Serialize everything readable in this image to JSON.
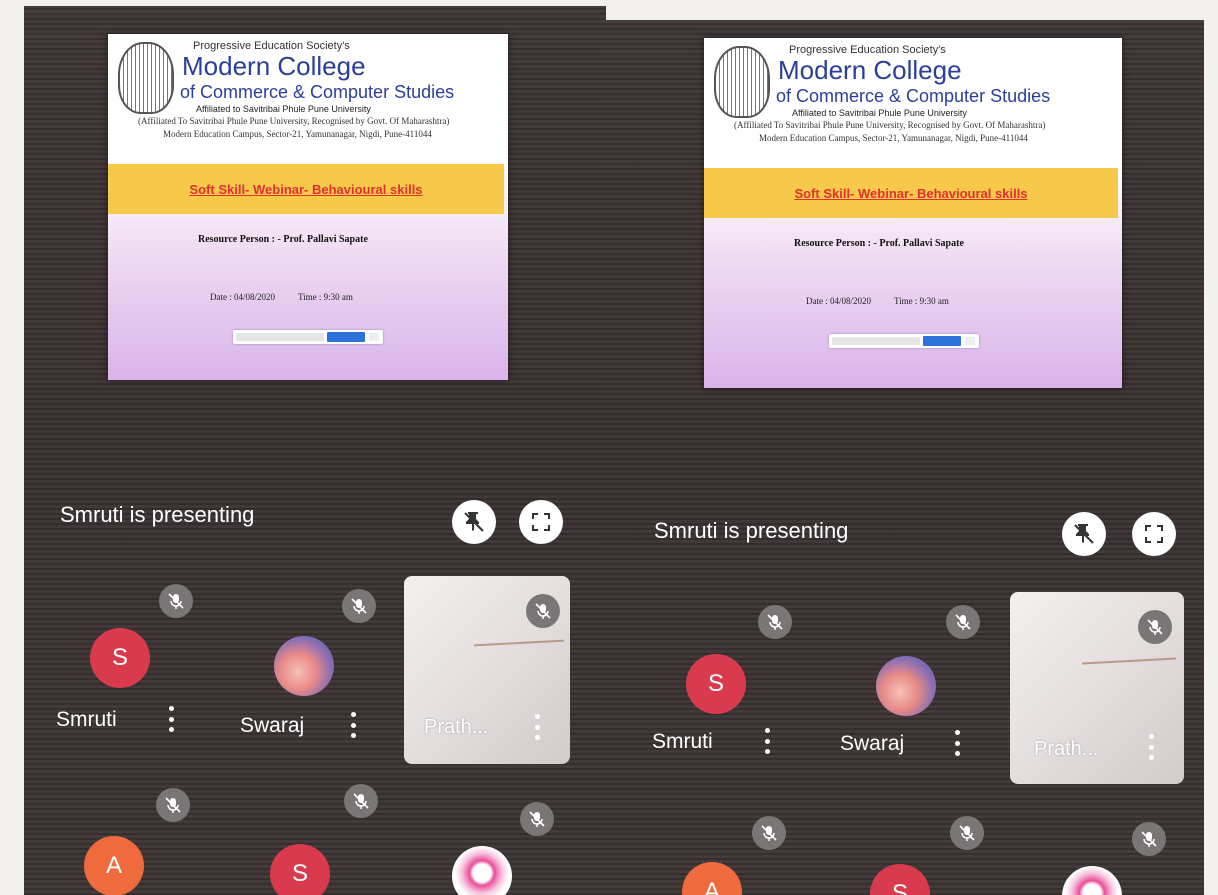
{
  "slide": {
    "society": "Progressive Education Society's",
    "college_line1": "Modern College",
    "college_line2": "of Commerce & Computer Studies",
    "affiliation": "Affiliated to Savitribai Phule Pune University",
    "affiliation_detail": "(Affiliated To Savitribai Phule Pune University, Recognised by Govt. Of Maharashtra)",
    "address": "Modern Education Campus, Sector-21, Yamunanagar, Nigdi, Pune-411044",
    "title": "Soft Skill- Webinar-  Behavioural skills",
    "resource_person": "Resource Person : - Prof. Pallavi Sapate",
    "date": "Date : 04/08/2020",
    "time": "Time : 9:30 am"
  },
  "presenting_text": "Smruti is presenting",
  "icons": {
    "unpin": "unpin-icon",
    "fullscreen": "fullscreen-icon",
    "mic_off": "mic-off-icon",
    "more": "more-vert-icon"
  },
  "participants": [
    {
      "name": "Smruti",
      "initial": "S",
      "color": "#d93a4e"
    },
    {
      "name": "Swaraj",
      "initial": "",
      "color": "#6a6fb7"
    },
    {
      "name": "Prath...",
      "initial": "",
      "color": "#e9e2e2"
    },
    {
      "name": "",
      "initial": "A",
      "color": "#ef6a3c"
    },
    {
      "name": "",
      "initial": "S",
      "color": "#d93a4e"
    },
    {
      "name": "",
      "initial": "",
      "color": "#e94f9a"
    }
  ]
}
